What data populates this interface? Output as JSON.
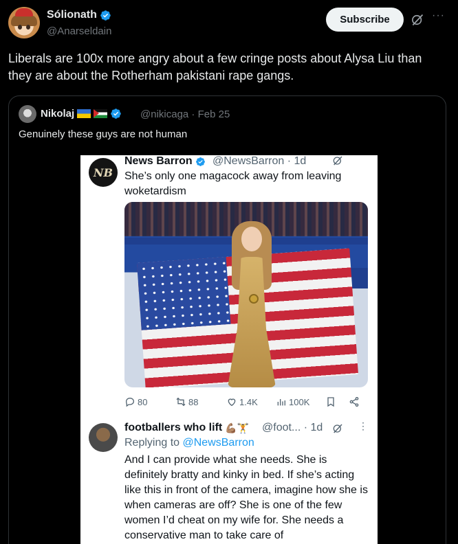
{
  "post": {
    "author_name": "Sólionath",
    "author_handle": "@Anarseldain",
    "subscribe_label": "Subscribe",
    "text": "Liberals are 100x more angry about a few cringe posts about Alysa Liu than they are about the Rotherham pakistani rape gangs."
  },
  "quote": {
    "author_name": "Nikolaj",
    "handle_date": "@nikicaga · Feb 25",
    "text": "Genuinely these guys are not human"
  },
  "screenshot": {
    "tweet1": {
      "logo_text": "NB",
      "name": "News Barron",
      "handle_time": "@NewsBarron · 1d",
      "text": "She’s only one magacock away from leaving woketardism",
      "stats": {
        "replies": "80",
        "reposts": "88",
        "likes": "1.4K",
        "views": "100K"
      }
    },
    "tweet2": {
      "name": "footballers who lift",
      "emoji": "💪🏽🏋",
      "handle_time": "@foot... · 1d",
      "more": "⋮",
      "reply_prefix": "Replying to ",
      "reply_handle": "@NewsBarron",
      "text": "And I can provide what she needs. She is definitely bratty and kinky in bed. If she’s acting like this in front of the camera, imagine how she is when cameras are off? She is one of the few women I’d cheat on my wife for. She needs a conservative man to take care of"
    }
  },
  "colors": {
    "background": "#000000",
    "accent": "#1d9bf0",
    "secondary_text": "#71767b"
  },
  "icons": [
    "verified-badge-icon",
    "grok-icon",
    "more-icon",
    "reply-icon",
    "repost-icon",
    "like-icon",
    "views-icon",
    "bookmark-icon",
    "share-icon"
  ]
}
